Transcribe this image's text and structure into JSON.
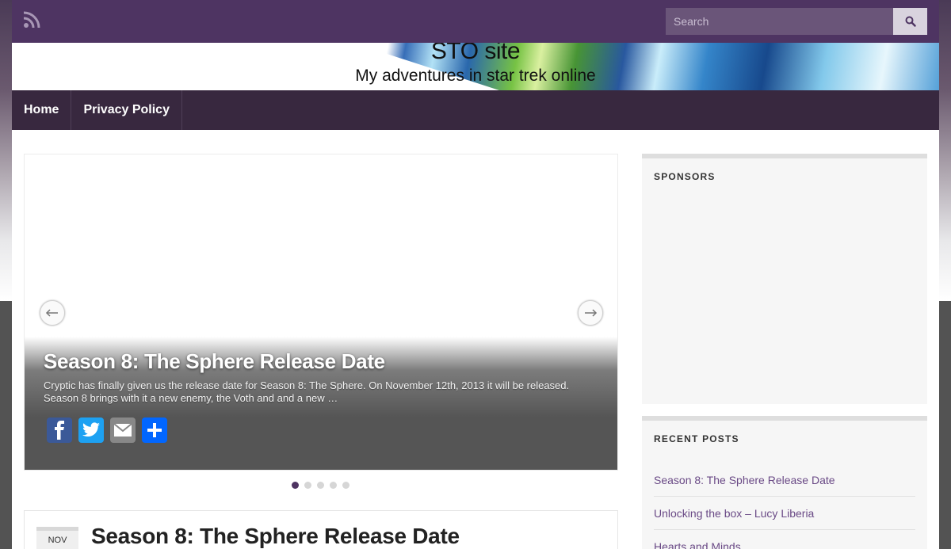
{
  "topbar": {
    "rss_icon": "rss-icon",
    "search": {
      "placeholder": "Search",
      "value": ""
    },
    "search_icon": "search-icon"
  },
  "header": {
    "site_title": "STO site",
    "tagline": "My adventures in star trek online"
  },
  "nav": {
    "items": [
      {
        "label": "Home"
      },
      {
        "label": "Privacy Policy"
      }
    ]
  },
  "slider": {
    "title": "Season 8: The Sphere Release Date",
    "excerpt": "Cryptic has finally given us the release date for Season 8: The Sphere. On November 12th, 2013 it will be released. Season 8 brings with it a new enemy, the Voth and and a new …",
    "prev_icon": "arrow-left-icon",
    "next_icon": "arrow-right-icon",
    "share": [
      {
        "name": "Facebook",
        "icon": "facebook-icon",
        "color": "#3b5998"
      },
      {
        "name": "Twitter",
        "icon": "twitter-icon",
        "color": "#1da1f2"
      },
      {
        "name": "Email",
        "icon": "email-icon",
        "color": "#888888"
      },
      {
        "name": "Share",
        "icon": "share-icon",
        "color": "#0166ff"
      }
    ],
    "dots_count": 5,
    "active_dot": 1
  },
  "post": {
    "month": "NOV",
    "title": "Season 8: The Sphere Release Date"
  },
  "sidebar": {
    "sponsors_title": "SPONSORS",
    "recent_title": "RECENT POSTS",
    "recent_posts": [
      "Season 8: The Sphere Release Date",
      "Unlocking the box – Lucy Liberia",
      "Hearts and Minds"
    ]
  },
  "colors": {
    "brand_purple": "#4e3462",
    "nav_bg": "#38283f",
    "link": "#6a4a86"
  }
}
